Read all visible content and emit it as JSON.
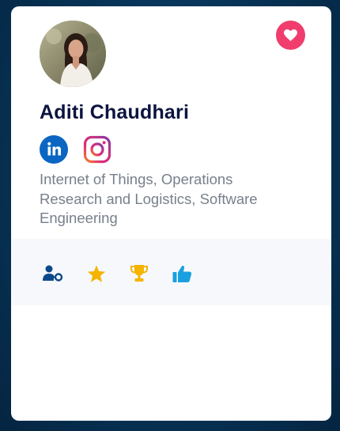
{
  "profile": {
    "name": "Aditi Chaudhari",
    "interests": "Internet of Things, Operations Research and Logistics, Software Engineering"
  },
  "social": {
    "linkedin_icon": "linkedin-icon",
    "instagram_icon": "instagram-icon"
  },
  "actions": [
    {
      "icon": "user-key-icon",
      "color": "#0b4a8a"
    },
    {
      "icon": "star-icon",
      "color": "#f5b400"
    },
    {
      "icon": "trophy-icon",
      "color": "#f5b400"
    },
    {
      "icon": "thumbs-up-icon",
      "color": "#1aa0e0"
    }
  ],
  "colors": {
    "favorite": "#f03d6e",
    "linkedin": "#0a66c2",
    "name": "#0b1440",
    "interests": "#78808c"
  }
}
